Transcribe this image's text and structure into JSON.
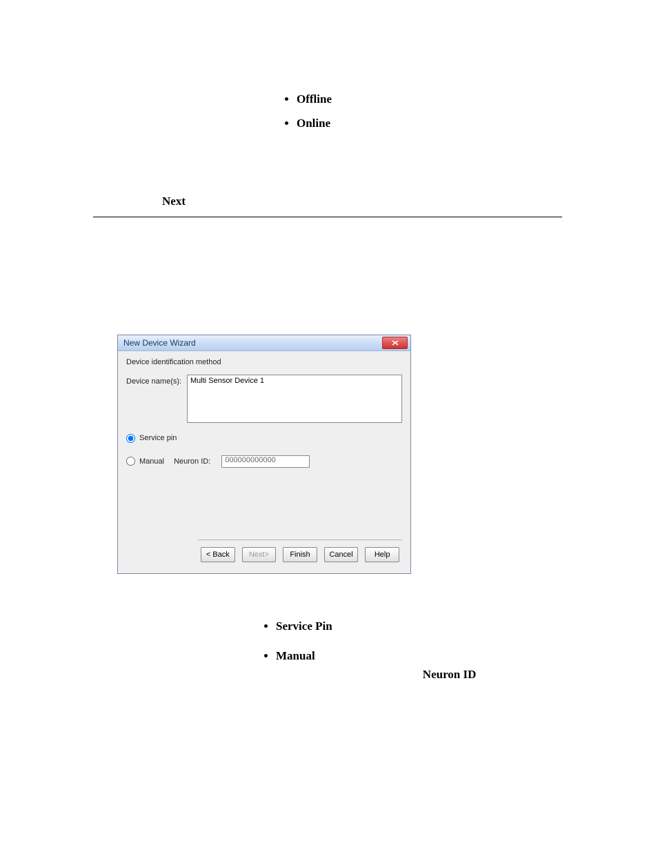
{
  "top_list": {
    "items": [
      "Offline",
      "Online"
    ]
  },
  "next_word": "Next",
  "dialog": {
    "title": "New Device Wizard",
    "subtitle": "Device identification method",
    "device_name_label": "Device name(s):",
    "device_name_value": "Multi Sensor Device 1",
    "radio_service_pin": "Service pin",
    "radio_manual": "Manual",
    "neuron_id_label": "Neuron ID:",
    "neuron_id_value": "000000000000",
    "buttons": {
      "back": "< Back",
      "next": "Next>",
      "finish": "Finish",
      "cancel": "Cancel",
      "help": "Help"
    }
  },
  "bottom_list": {
    "items": [
      {
        "bold": "Service Pin"
      },
      {
        "bold": "Manual"
      }
    ],
    "trailing_bold": "Neuron ID"
  }
}
